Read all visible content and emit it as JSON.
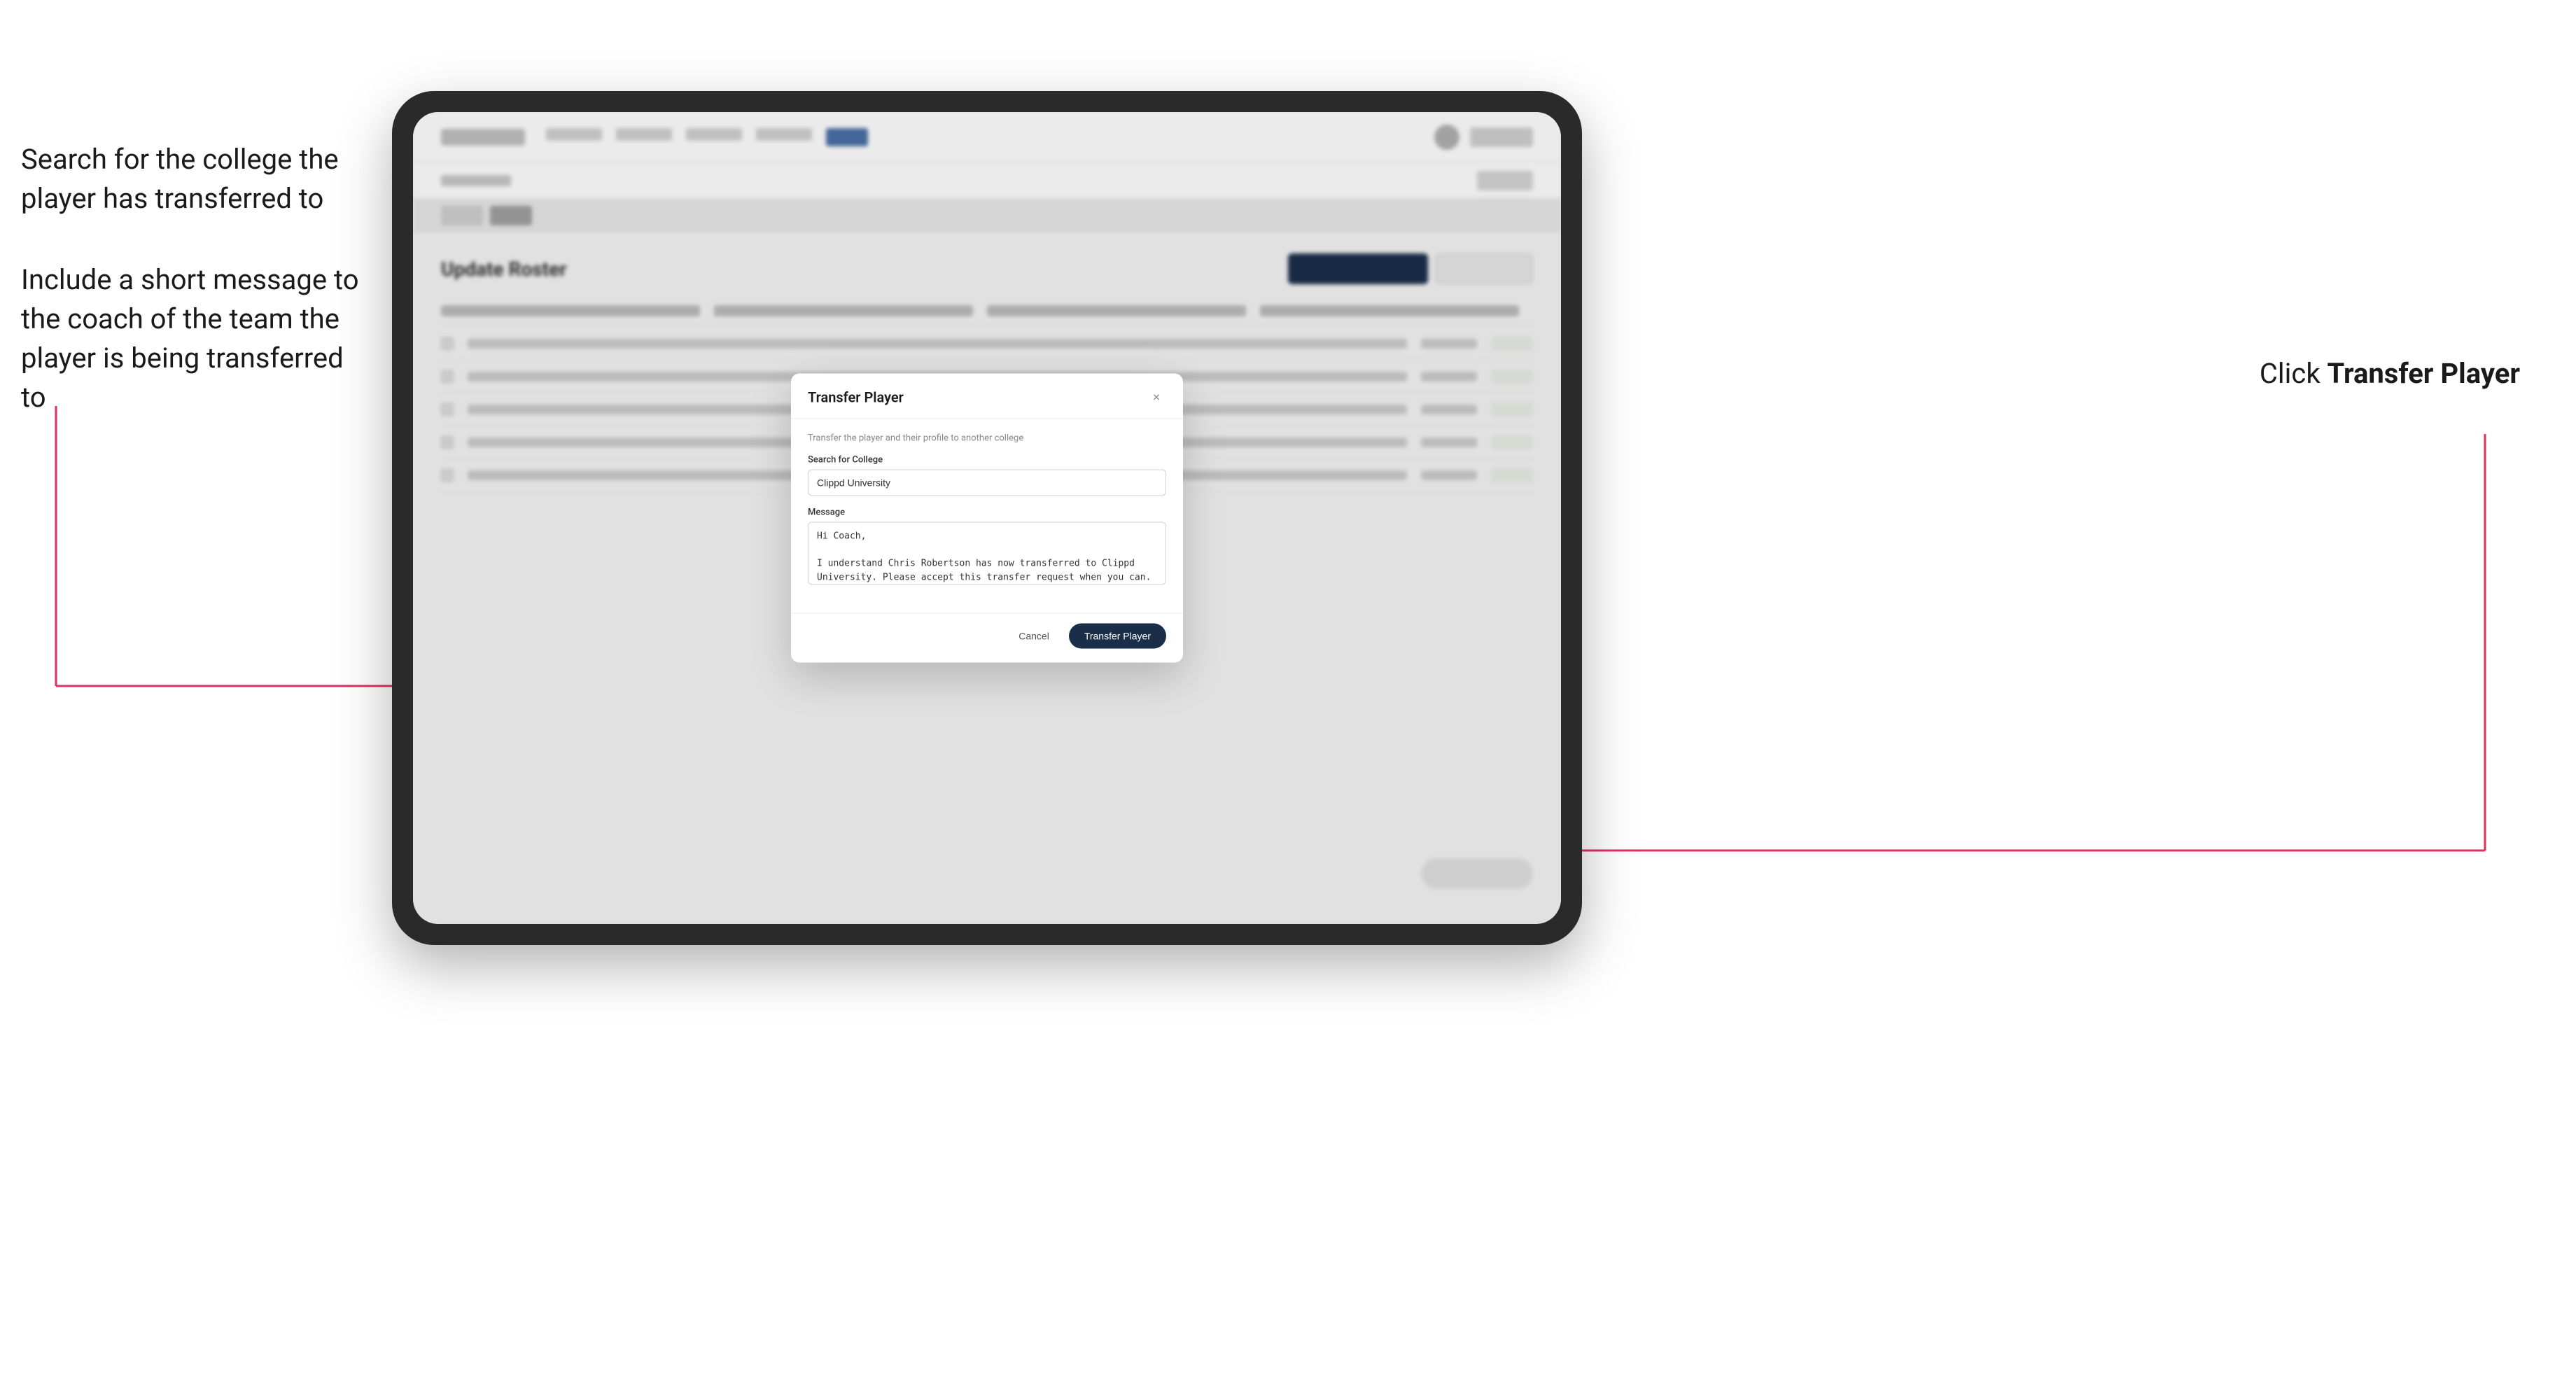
{
  "annotations": {
    "left_top": "Search for the college the player has transferred to",
    "left_bottom": "Include a short message to the coach of the team the player is being transferred to",
    "right": "Click ",
    "right_bold": "Transfer Player"
  },
  "tablet": {
    "nav": {
      "logo": "",
      "active_tab": ""
    }
  },
  "modal": {
    "title": "Transfer Player",
    "close_label": "×",
    "subtitle": "Transfer the player and their profile to another college",
    "college_label": "Search for College",
    "college_value": "Clippd University",
    "message_label": "Message",
    "message_value": "Hi Coach,\n\nI understand Chris Robertson has now transferred to Clippd University. Please accept this transfer request when you can.",
    "cancel_label": "Cancel",
    "transfer_label": "Transfer Player"
  },
  "page": {
    "title": "Update Roster"
  }
}
